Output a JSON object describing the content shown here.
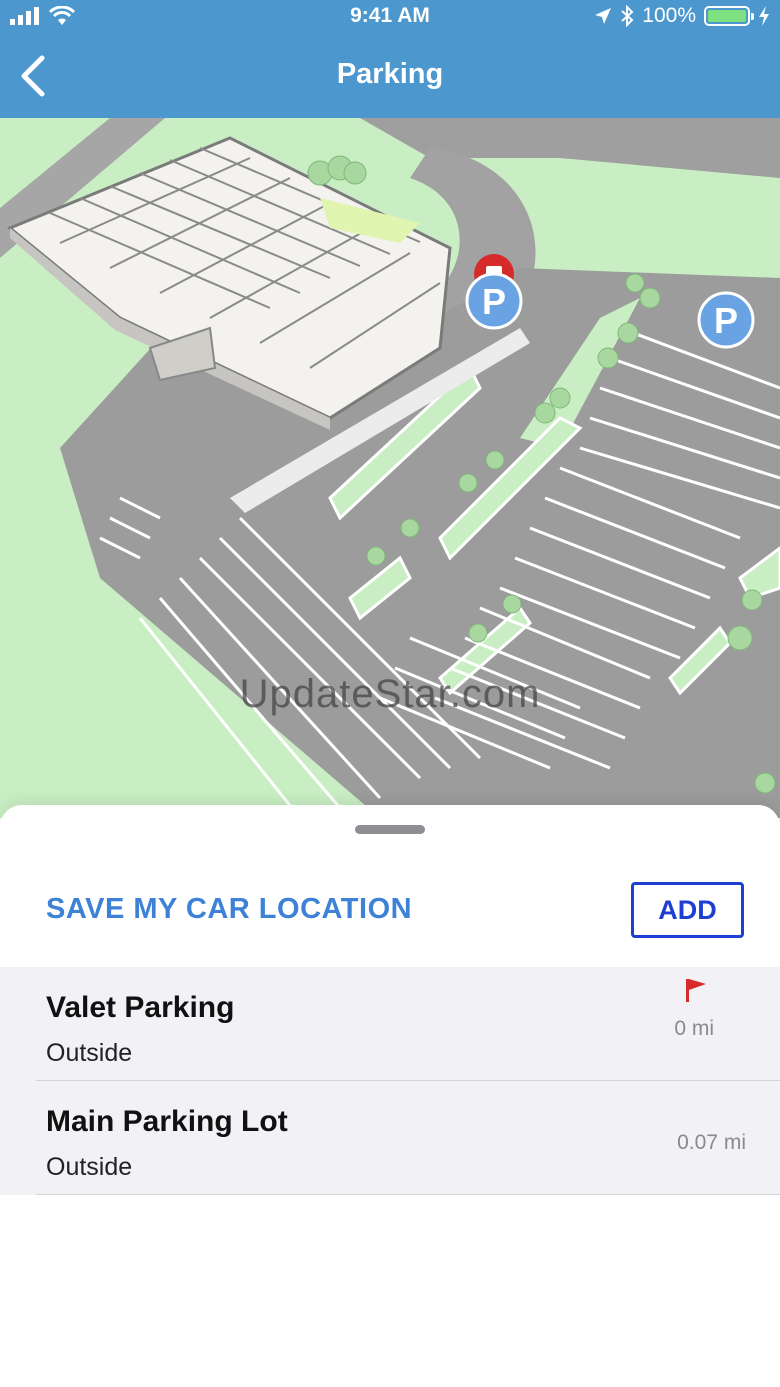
{
  "status_bar": {
    "time": "9:41 AM",
    "battery": "100%",
    "battery_level": 1.0,
    "icons": [
      "signal-icon",
      "wifi-icon",
      "location-arrow-icon",
      "bluetooth-icon",
      "battery-icon",
      "charging-icon"
    ]
  },
  "nav": {
    "title": "Parking",
    "back_icon": "chevron-left-icon"
  },
  "map": {
    "watermark": "UpdateStar.com",
    "markers": [
      "parking-marker",
      "parking-marker",
      "store-marker"
    ],
    "parking_marker_label": "P"
  },
  "sheet": {
    "save_label": "SAVE MY CAR LOCATION",
    "add_label": "ADD"
  },
  "parking_list": [
    {
      "name": "Valet Parking",
      "location": "Outside",
      "distance": "0 mi",
      "flagged": true
    },
    {
      "name": "Main Parking Lot",
      "location": "Outside",
      "distance": "0.07 mi",
      "flagged": false
    }
  ],
  "colors": {
    "header": "#4d97cf",
    "accent": "#3d82d6",
    "add_button": "#1e3fd4",
    "flag": "#d62b2b",
    "grass": "#c9eec3",
    "road": "#9c9c9c",
    "parking_marker": "#6aa3e4"
  }
}
